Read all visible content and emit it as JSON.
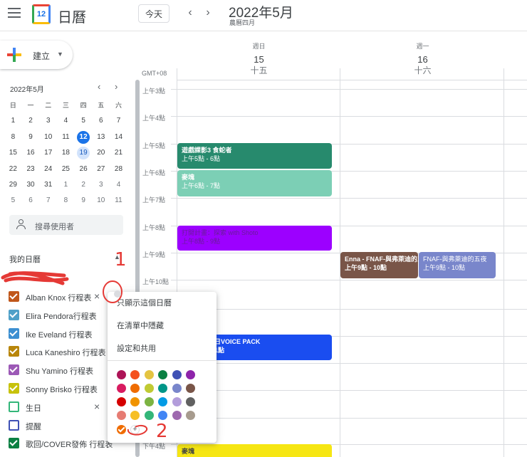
{
  "header": {
    "app_title": "日曆",
    "logo_text": "12",
    "today_label": "今天",
    "month": "2022年5月",
    "lunar": "農曆四月"
  },
  "create": {
    "label": "建立"
  },
  "mini_cal": {
    "title": "2022年5月",
    "dow": [
      "日",
      "一",
      "二",
      "三",
      "四",
      "五",
      "六"
    ],
    "weeks": [
      [
        "1",
        "2",
        "3",
        "4",
        "5",
        "6",
        "7"
      ],
      [
        "8",
        "9",
        "10",
        "11",
        "12",
        "13",
        "14"
      ],
      [
        "15",
        "16",
        "17",
        "18",
        "19",
        "20",
        "21"
      ],
      [
        "22",
        "23",
        "24",
        "25",
        "26",
        "27",
        "28"
      ],
      [
        "29",
        "30",
        "31",
        "1",
        "2",
        "3",
        "4"
      ],
      [
        "5",
        "6",
        "7",
        "8",
        "9",
        "10",
        "11"
      ]
    ]
  },
  "search_people": {
    "label": "搜尋使用者"
  },
  "my_calendars": {
    "title": "我的日曆",
    "items": [
      {
        "name": "Alban Knox 行程表",
        "color": "#c0571b",
        "checked": true,
        "x": true
      },
      {
        "name": "Elira Pendora行程表",
        "color": "#4fa0c8",
        "checked": true,
        "x": false
      },
      {
        "name": "Ike Eveland 行程表",
        "color": "#3c8fd1",
        "checked": true,
        "x": false
      },
      {
        "name": "Luca Kaneshiro 行程表",
        "color": "#b8860b",
        "checked": true,
        "x": false
      },
      {
        "name": "Shu Yamino 行程表",
        "color": "#9c59b6",
        "checked": true,
        "x": false
      },
      {
        "name": "Sonny Brisko 行程表",
        "color": "#c7c20c",
        "checked": true,
        "x": false
      },
      {
        "name": "生日",
        "color": "#33b679",
        "checked": false,
        "x": true
      },
      {
        "name": "提醒",
        "color": "#3f51b5",
        "checked": false,
        "x": false
      },
      {
        "name": "歌回/COVER發佈 行程表",
        "color": "#0b8043",
        "checked": true,
        "x": false
      }
    ]
  },
  "grid": {
    "gmt": "GMT+08",
    "days": [
      {
        "dow": "週日",
        "num": "15",
        "lunar": "十五"
      },
      {
        "dow": "週一",
        "num": "16",
        "lunar": "十六"
      }
    ],
    "hours": [
      "上午3點",
      "上午4點",
      "上午5點",
      "上午6點",
      "上午7點",
      "上午8點",
      "上午9點",
      "上午10點",
      "下午4點"
    ]
  },
  "events": [
    {
      "title": "遊戲課影3 食蛇者",
      "time": "上午5點 - 6點",
      "color": "#278a6d"
    },
    {
      "title": "麥塊",
      "time": "上午6點 - 7點",
      "color": "#7ccfb5"
    },
    {
      "title": "打開計畫：探索 with Shoto",
      "time": "上午8點 - 9點",
      "color": "#9c00ff"
    },
    {
      "title": "Enna - FNAF-與弗萊迪的五夜",
      "time": "上午9點 - 10點",
      "color": "#795548"
    },
    {
      "title": "FNAF-與弗萊迪的五夜",
      "time": "上午9點 - 10點",
      "color": "#7986cb"
    },
    {
      "title": "日VOICE PACK",
      "time": "1點",
      "color": "#1a4df0"
    },
    {
      "title": "麥塊",
      "time": "",
      "color": "#f6e613"
    }
  ],
  "menu": {
    "items": [
      "只顯示這個日曆",
      "在清單中隱藏",
      "設定和共用"
    ],
    "colors": [
      [
        "#ad1457",
        "#f4511e",
        "#e4c441",
        "#0b8043",
        "#3f51b5",
        "#8e24aa"
      ],
      [
        "#d81b60",
        "#ef6c00",
        "#c0ca33",
        "#009688",
        "#7986cb",
        "#795548"
      ],
      [
        "#d50000",
        "#f09300",
        "#7cb342",
        "#039be5",
        "#b39ddb",
        "#616161"
      ],
      [
        "#e67c73",
        "#f6bf26",
        "#33b679",
        "#4285f4",
        "#9e69af",
        "#a79b8e"
      ]
    ],
    "selected_color": "#ef6c00",
    "add_label": "+"
  },
  "annotations": {
    "one": "1",
    "two": "2"
  }
}
